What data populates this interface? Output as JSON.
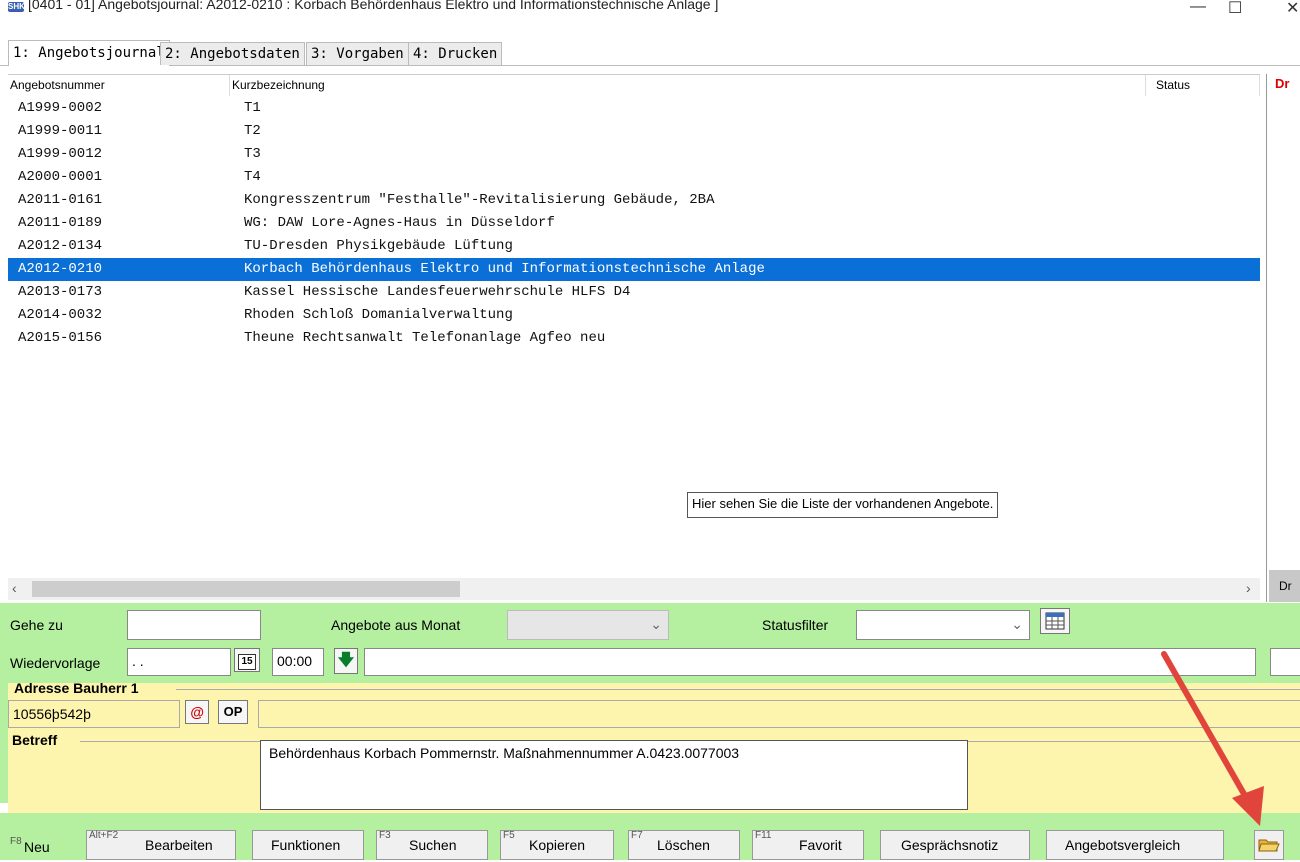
{
  "window": {
    "title": "[0401 - 01] Angebotsjournal: A2012-0210 : Korbach Behördenhaus Elektro und Informationstechnische Anlage ]",
    "app_icon": "app-logo-icon",
    "minimize": "—",
    "maximize": "☐",
    "close": "✕"
  },
  "tabs": [
    {
      "label": "1: Angebotsjournal",
      "active": true
    },
    {
      "label": "2: Angebotsdaten",
      "active": false
    },
    {
      "label": "3: Vorgaben",
      "active": false
    },
    {
      "label": "4: Drucken",
      "active": false
    }
  ],
  "list": {
    "columns": [
      "Angebotsnummer",
      "Kurzbezeichnung",
      "Status"
    ],
    "rows": [
      {
        "nr": "A1999-0002",
        "bez": "T1"
      },
      {
        "nr": "A1999-0011",
        "bez": "T2"
      },
      {
        "nr": "A1999-0012",
        "bez": "T3"
      },
      {
        "nr": "A2000-0001",
        "bez": "T4"
      },
      {
        "nr": "A2011-0161",
        "bez": "Kongresszentrum \"Festhalle\"-Revitalisierung Gebäude, 2BA"
      },
      {
        "nr": "A2011-0189",
        "bez": "WG: DAW Lore-Agnes-Haus in Düsseldorf"
      },
      {
        "nr": "A2012-0134",
        "bez": "TU-Dresden Physikgebäude Lüftung"
      },
      {
        "nr": "A2012-0210",
        "bez": "Korbach Behördenhaus Elektro und Informationstechnische Anlage",
        "selected": true
      },
      {
        "nr": "A2013-0173",
        "bez": "Kassel Hessische Landesfeuerwehrschule HLFS D4"
      },
      {
        "nr": "A2014-0032",
        "bez": "Rhoden Schloß Domanialverwaltung"
      },
      {
        "nr": "A2015-0156",
        "bez": "Theune Rechtsanwalt Telefonanlage Agfeo neu"
      }
    ],
    "tooltip": "Hier sehen Sie die Liste der vorhandenen Angebote."
  },
  "right_pane": {
    "label_top": "Dr",
    "label_bottom": "Dr"
  },
  "scroll": {
    "left_arrow": "‹",
    "right_arrow": "›"
  },
  "filters": {
    "gehe_zu_label": "Gehe zu",
    "gehe_zu_value": "",
    "monat_label": "Angebote  aus Monat",
    "monat_value": "",
    "status_label": "Statusfilter",
    "status_value": "",
    "wiedervorlage_label": "Wiedervorlage",
    "wiedervorlage_date": " . .",
    "wiedervorlage_time": "00:00",
    "calendar_day": "15",
    "wiedervorlage_note": ""
  },
  "adresse": {
    "title": "Adresse Bauherr 1",
    "value": "10556þ542þ",
    "op_label": "OP",
    "at_label": "@"
  },
  "betreff": {
    "title": "Betreff",
    "text": "Behördenhaus Korbach Pommernstr. Maßnahmennummer A.0423.0077003"
  },
  "buttons": [
    {
      "key": "F8",
      "label": "Neu"
    },
    {
      "key": "Alt+F2",
      "label": "Bearbeiten"
    },
    {
      "key": "",
      "label": "Funktionen"
    },
    {
      "key": "F3",
      "label": "Suchen"
    },
    {
      "key": "F5",
      "label": "Kopieren"
    },
    {
      "key": "F7",
      "label": "Löschen"
    },
    {
      "key": "F11",
      "label": "Favorit"
    },
    {
      "key": "",
      "label": "Gesprächsnotiz"
    },
    {
      "key": "",
      "label": "Angebotsvergleich"
    }
  ],
  "colors": {
    "selection": "#0a6fd6",
    "green_panel": "#b4f0a0",
    "yellow_panel": "#fdf4ad",
    "annotation_arrow": "#e0443a"
  }
}
